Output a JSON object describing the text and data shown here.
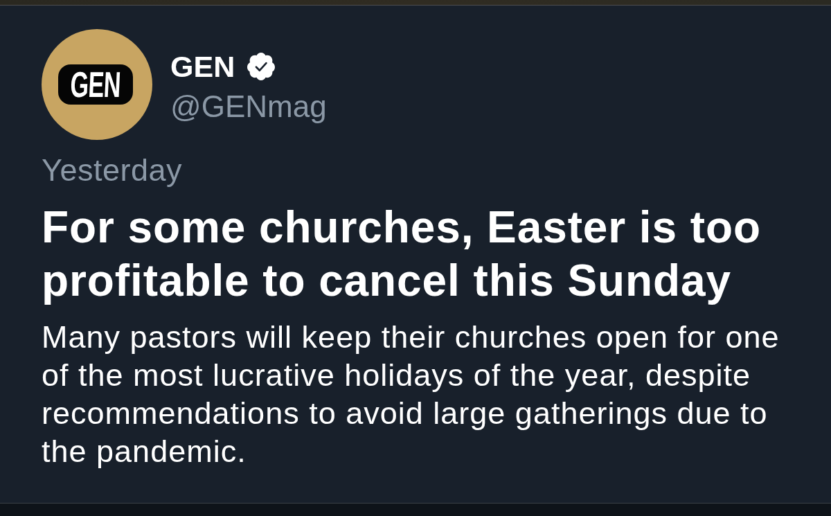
{
  "account": {
    "avatar": {
      "logo_text": "GEN"
    },
    "name": "GEN",
    "verified": true,
    "handle": "@GENmag"
  },
  "timestamp": "Yesterday",
  "headline": "For some churches, Easter is too profitable to cancel this Sunday",
  "summary": "Many pastors will keep their churches open for one of the most lucrative holidays of the year, despite recommendations to avoid large gatherings due to the pandemic."
}
